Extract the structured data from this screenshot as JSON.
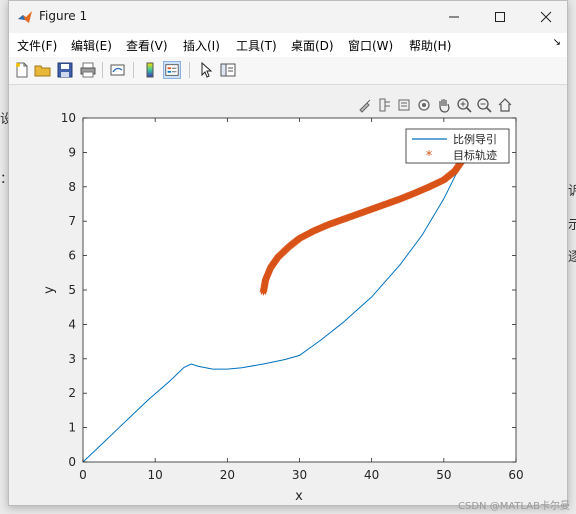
{
  "window": {
    "title": "Figure 1"
  },
  "menubar": {
    "items": [
      "文件(F)",
      "编辑(E)",
      "查看(V)",
      "插入(I)",
      "工具(T)",
      "桌面(D)",
      "窗口(W)",
      "帮助(H)"
    ]
  },
  "toolbar": {
    "buttons": [
      "new-figure-icon",
      "open-file-icon",
      "save-icon",
      "print-icon",
      "link-plot-icon",
      "colorbar-icon",
      "legend-icon",
      "pointer-icon",
      "property-inspector-icon"
    ]
  },
  "axes_toolbar": [
    "brush-icon",
    "data-tips-icon",
    "rotate-icon",
    "pan-icon",
    "zoom-in-icon",
    "zoom-out-icon",
    "home-icon",
    "export-icon"
  ],
  "colors": {
    "series_line": "#0072bd",
    "series_marker": "#d95319",
    "accent": "#cde2f7"
  },
  "chart_data": {
    "type": "line",
    "xlabel": "x",
    "ylabel": "y",
    "xlim": [
      0,
      60
    ],
    "ylim": [
      0,
      10
    ],
    "x_ticks": [
      0,
      10,
      20,
      30,
      40,
      50,
      60
    ],
    "y_ticks": [
      0,
      1,
      2,
      3,
      4,
      5,
      6,
      7,
      8,
      9,
      10
    ],
    "grid": false,
    "legend_position": "top-right",
    "series": [
      {
        "name": "比例导引",
        "style": "line",
        "points": [
          [
            0,
            0
          ],
          [
            3,
            0.6
          ],
          [
            6,
            1.2
          ],
          [
            9,
            1.8
          ],
          [
            12,
            2.35
          ],
          [
            14,
            2.75
          ],
          [
            15,
            2.85
          ],
          [
            16,
            2.78
          ],
          [
            18,
            2.7
          ],
          [
            20,
            2.7
          ],
          [
            22,
            2.74
          ],
          [
            25,
            2.85
          ],
          [
            28,
            2.98
          ],
          [
            30,
            3.1
          ],
          [
            33,
            3.55
          ],
          [
            36,
            4.05
          ],
          [
            40,
            4.8
          ],
          [
            44,
            5.75
          ],
          [
            47,
            6.6
          ],
          [
            50,
            7.65
          ],
          [
            52,
            8.5
          ],
          [
            53,
            8.95
          ],
          [
            54,
            9.4
          ]
        ]
      },
      {
        "name": "目标轨迹",
        "style": "markers",
        "points": [
          [
            25,
            4.95
          ],
          [
            25.3,
            5.3
          ],
          [
            26,
            5.65
          ],
          [
            27,
            5.95
          ],
          [
            28.5,
            6.25
          ],
          [
            30,
            6.5
          ],
          [
            32,
            6.72
          ],
          [
            34,
            6.9
          ],
          [
            36,
            7.05
          ],
          [
            38,
            7.2
          ],
          [
            40,
            7.35
          ],
          [
            42,
            7.5
          ],
          [
            44,
            7.65
          ],
          [
            46,
            7.82
          ],
          [
            48,
            8.0
          ],
          [
            50,
            8.2
          ],
          [
            51.5,
            8.45
          ],
          [
            52.5,
            8.75
          ],
          [
            53.5,
            9.15
          ],
          [
            54.3,
            9.5
          ]
        ]
      }
    ]
  },
  "watermark": "CSDN @MATLAB卡尔曼"
}
